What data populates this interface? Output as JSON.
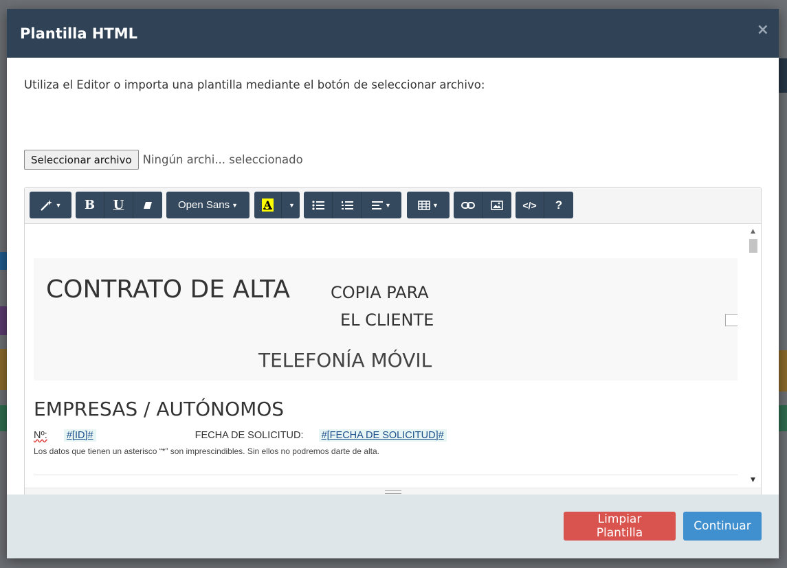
{
  "modal": {
    "title": "Plantilla HTML",
    "close": "×",
    "intro": "Utiliza el Editor o importa una plantilla mediante el botón de seleccionar archivo:",
    "file_button": "Seleccionar archivo",
    "file_status": "Ningún archi... seleccionado"
  },
  "toolbar": {
    "font_name": "Open Sans",
    "bold": "B",
    "underline": "U",
    "color_letter": "A",
    "code": "</>",
    "help": "?"
  },
  "doc": {
    "title": "CONTRATO DE ALTA",
    "copy_line1": "COPIA PARA",
    "copy_line2": "EL CLIENTE",
    "subtitle": "TELEFONÍA MÓVIL",
    "section": "EMPRESAS / AUTÓNOMOS",
    "number_label": "Nº:",
    "id_tag": "#[ID]#",
    "date_label": "FECHA DE SOLICITUD:",
    "date_tag": "#[FECHA DE SOLICITUD]#",
    "note": "Los datos que tienen un asterisco “*” son imprescindibles. Sin ellos no podremos darte de alta."
  },
  "footer": {
    "clear_label": "Limpiar Plantilla",
    "continue_label": "Continuar"
  },
  "colors": {
    "header_bg": "#2f4256",
    "toolbar_btn": "#34495e",
    "danger": "#d9534f",
    "primary": "#4090d0",
    "footer_bg": "#dfe6ea"
  }
}
